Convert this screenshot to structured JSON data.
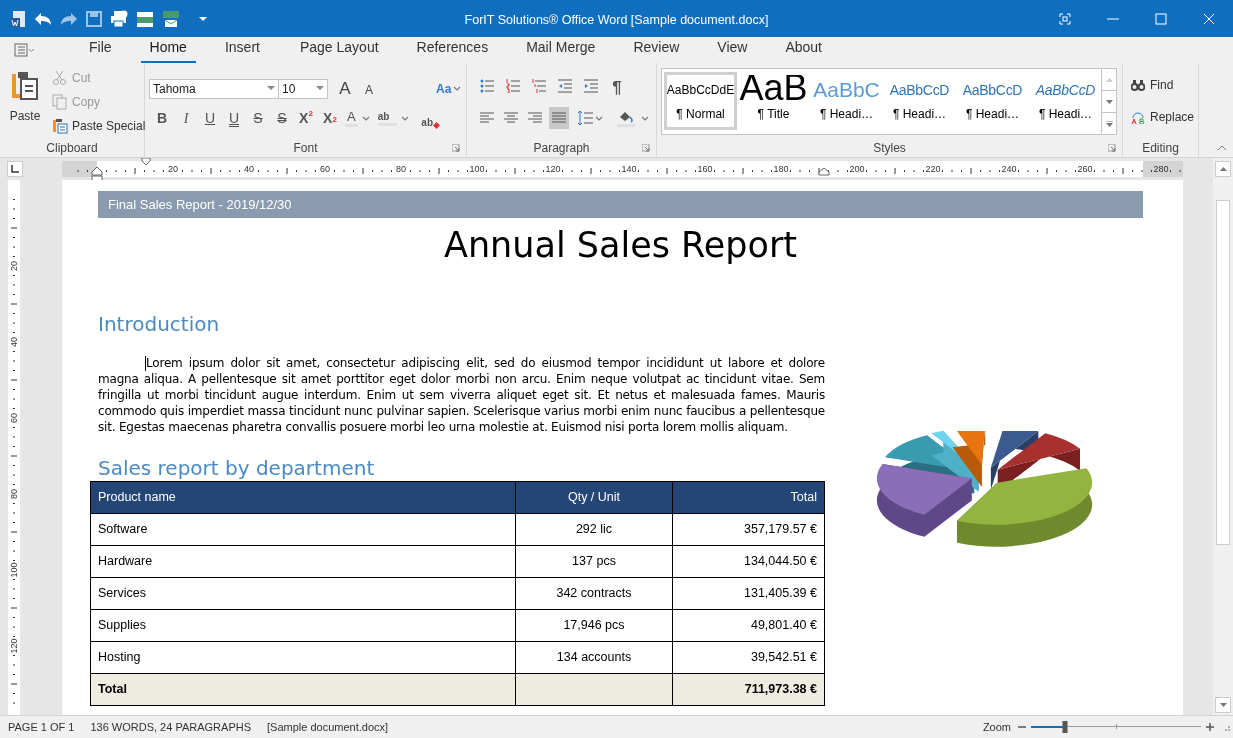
{
  "window": {
    "title": "ForIT Solutions® Office Word [Sample document.docx]"
  },
  "tabs": [
    {
      "label": "File",
      "selected": false
    },
    {
      "label": "Home",
      "selected": true
    },
    {
      "label": "Insert",
      "selected": false
    },
    {
      "label": "Page Layout",
      "selected": false
    },
    {
      "label": "References",
      "selected": false
    },
    {
      "label": "Mail Merge",
      "selected": false
    },
    {
      "label": "Review",
      "selected": false
    },
    {
      "label": "View",
      "selected": false
    },
    {
      "label": "About",
      "selected": false
    }
  ],
  "ribbon": {
    "clipboard": {
      "label": "Clipboard",
      "paste": "Paste",
      "items": [
        {
          "kind": "cut",
          "label": "Cut",
          "disabled": true
        },
        {
          "kind": "copy",
          "label": "Copy",
          "disabled": true
        },
        {
          "kind": "paste_special",
          "label": "Paste Special",
          "disabled": false
        }
      ]
    },
    "font": {
      "label": "Font",
      "font_name": "Tahoma",
      "font_size": "10",
      "grow": "A",
      "shrink": "A",
      "change_case": "Aa",
      "buttons": [
        {
          "kind": "bold",
          "text": "B"
        },
        {
          "kind": "italic",
          "text": "I"
        },
        {
          "kind": "underline",
          "text": "U"
        },
        {
          "kind": "double_underline",
          "text": "U"
        },
        {
          "kind": "strike",
          "text": "S"
        },
        {
          "kind": "double_strike",
          "text": "S"
        },
        {
          "kind": "superscript",
          "text": "X$^{2}$"
        },
        {
          "kind": "subscript",
          "text": "X$_{2}$"
        },
        {
          "kind": "color",
          "text": "A"
        },
        {
          "kind": "highlight",
          "text": "ab"
        },
        {
          "kind": "clear",
          "text": "ab"
        }
      ]
    },
    "paragraph": {
      "label": "Paragraph",
      "show_marks": "¶",
      "alignments": [
        {
          "kind": "left",
          "selected": false
        },
        {
          "kind": "center",
          "selected": false
        },
        {
          "kind": "right",
          "selected": false
        },
        {
          "kind": "justify",
          "selected": true
        }
      ]
    },
    "styles": {
      "label": "Styles",
      "items": [
        {
          "kind": "normal",
          "preview": "AaBbCcDdE",
          "label": "¶ Normal",
          "selected": true
        },
        {
          "kind": "title",
          "preview": "AaB",
          "label": "¶ Title",
          "selected": false
        },
        {
          "kind": "heading1",
          "preview": "AaBbC",
          "label": "¶ Headi…",
          "selected": false
        },
        {
          "kind": "heading2",
          "preview": "AaBbCcD",
          "label": "¶ Headi…",
          "selected": false
        },
        {
          "kind": "heading3",
          "preview": "AaBbCcD",
          "label": "¶ Headi…",
          "selected": false
        },
        {
          "kind": "heading4",
          "preview": "AaBbCcD",
          "label": "¶ Headi…",
          "selected": false
        }
      ]
    },
    "editing": {
      "label": "Editing",
      "find": "Find",
      "replace": "Replace"
    }
  },
  "ruler": {
    "ticks": [
      "20",
      "40",
      "60",
      "80",
      "100",
      "120",
      "140",
      "160",
      "180",
      "200",
      "220",
      "240",
      "260",
      "280"
    ]
  },
  "vertical_ruler": {
    "ticks": [
      "20",
      "40",
      "60",
      "80",
      "100",
      "120"
    ]
  },
  "document": {
    "header_band": "Final Sales Report - 2019/12/30",
    "title": "Annual Sales Report",
    "intro_heading": "Introduction",
    "intro_text": "Lorem ipsum dolor sit amet, consectetur adipiscing elit, sed do eiusmod tempor incididunt ut labore et dolore magna aliqua. A pellentesque sit amet porttitor eget dolor morbi non arcu. Enim neque volutpat ac tincidunt vitae. Sem fringilla ut morbi tincidunt augue interdum. Enim ut sem viverra aliquet eget sit. Et netus et malesuada fames. Mauris commodo quis imperdiet massa tincidunt nunc pulvinar sapien. Scelerisque varius morbi enim nunc faucibus a pellentesque sit. Egestas maecenas pharetra convallis posuere morbi leo urna molestie at. Euismod nisi porta lorem mollis aliquam.",
    "table_heading": "Sales report by department",
    "table": {
      "columns": [
        "Product name",
        "Qty / Unit",
        "Total"
      ],
      "rows": [
        [
          "Software",
          "292 lic",
          "357,179.57 €"
        ],
        [
          "Hardware",
          "137 pcs",
          "134,044.50 €"
        ],
        [
          "Services",
          "342 contracts",
          "131,405.39 €"
        ],
        [
          "Supplies",
          "17,946 pcs",
          "49,801.40 €"
        ],
        [
          "Hosting",
          "134 accounts",
          "39,542.51 €"
        ]
      ],
      "total": {
        "label": "Total",
        "value": "711,973.38 €"
      }
    }
  },
  "status_bar": {
    "page": "PAGE 1 OF 1",
    "words": "136 WORDS, 24 PARAGRAPHS",
    "file": "[Sample document.docx]",
    "zoom_label": "Zoom",
    "zoom": {
      "level": 0.2
    }
  }
}
